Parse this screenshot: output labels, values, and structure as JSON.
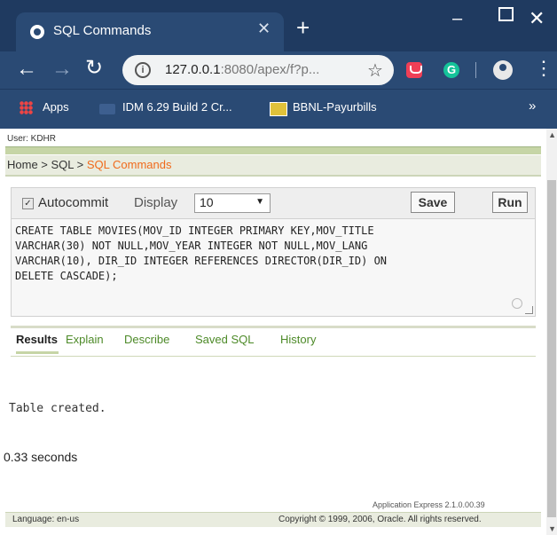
{
  "browser": {
    "tab_title": "SQL Commands",
    "tab_close": "✕",
    "new_tab": "+",
    "url_host": "127.0.0.1",
    "url_rest": ":8080/apex/f?p...",
    "ext_g": "G",
    "bookmarks": {
      "apps": "Apps",
      "idm": "IDM 6.29 Build 2 Cr...",
      "bbnl": "BBNL-Payurbills",
      "more": "»"
    }
  },
  "page": {
    "user_line": "User: KDHR",
    "breadcrumb": {
      "home": "Home",
      "sep1": " > ",
      "sql": "SQL",
      "sep2": " > ",
      "current": "SQL Commands"
    },
    "command": {
      "autocommit_label": "Autocommit",
      "display_label": "Display",
      "display_value": "10",
      "save_label": "Save",
      "run_label": "Run",
      "sql_text": "CREATE TABLE MOVIES(MOV_ID INTEGER PRIMARY KEY,MOV_TITLE\nVARCHAR(30) NOT NULL,MOV_YEAR INTEGER NOT NULL,MOV_LANG\nVARCHAR(10), DIR_ID INTEGER REFERENCES DIRECTOR(DIR_ID) ON\nDELETE CASCADE);"
    },
    "result_tabs": [
      "Results",
      "Explain",
      "Describe",
      "Saved SQL",
      "History"
    ],
    "output_message": "Table created.",
    "elapsed": "0.33 seconds",
    "app_version": "Application Express 2.1.0.00.39",
    "footer": {
      "language": "Language: en-us",
      "copyright": "Copyright © 1999, 2006, Oracle. All rights reserved."
    }
  },
  "colors": {
    "accent_orange": "#f06a1b",
    "link_green": "#4d8a28",
    "chrome_blue": "#2a4a74"
  }
}
